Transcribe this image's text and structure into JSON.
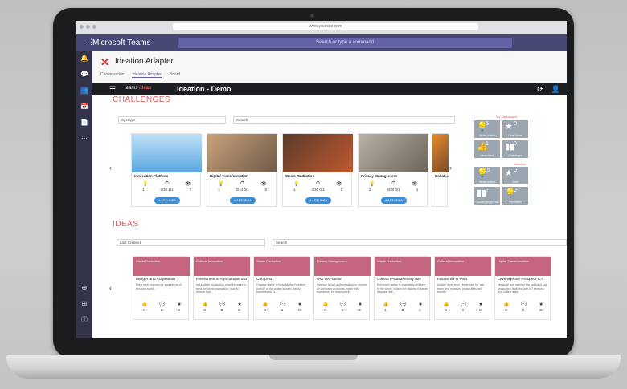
{
  "browser": {
    "url": "www.yoursite.com"
  },
  "teams": {
    "app_name": "Microsoft Teams",
    "search_placeholder": "Search or type a command",
    "rail": [
      "Activity",
      "Chat",
      "Teams",
      "Meetings",
      "Files",
      "...",
      "Apps",
      "Store",
      "Help"
    ]
  },
  "app": {
    "name": "Ideation Adapter",
    "tabs": [
      "Conversation",
      "Ideation Adapter",
      "Board"
    ],
    "bar_title": "Ideation - Demo",
    "brand_text": "teams",
    "brand_accent": "ideas"
  },
  "challenges": {
    "heading": "CHALLENGES",
    "filter_label": "Spotlight",
    "search_placeholder": "Search",
    "cards": [
      {
        "title": "Innovation Platform",
        "likes": "1",
        "date": "3/30 1/1",
        "views": "7",
        "add": "+ ADD IDEA"
      },
      {
        "title": "Digital Transformation",
        "likes": "1",
        "date": "2/14 0/1",
        "views": "0",
        "add": "+ ADD IDEA"
      },
      {
        "title": "Waste Reduction",
        "likes": "1",
        "date": "3/30 0/1",
        "views": "2",
        "add": "+ ADD IDEA"
      },
      {
        "title": "Privacy Management",
        "likes": "2",
        "date": "4/30 0/1",
        "views": "4",
        "add": "+ ADD IDEA"
      },
      {
        "title": "Collab...",
        "likes": "",
        "date": "",
        "views": "",
        "add": ""
      }
    ]
  },
  "stats": {
    "label1": "My Dashboard",
    "label2": "Ideation",
    "tiles": [
      {
        "num": "5",
        "label": "Ideas posted"
      },
      {
        "num": "0",
        "label": "Liked ideas"
      },
      {
        "num": "1",
        "label": "Ideas liked"
      },
      {
        "num": "0",
        "label": "Challenges"
      },
      {
        "num": "15",
        "label": "Ideas posted"
      },
      {
        "num": "0",
        "label": "Liked"
      },
      {
        "num": "7",
        "label": "Challenges posted"
      },
      {
        "num": "0",
        "label": "Reviewed"
      }
    ]
  },
  "ideas": {
    "heading": "IDEAS",
    "sort_label": "Last Created",
    "search_placeholder": "Search",
    "cards": [
      {
        "category": "Waste Reduction",
        "title": "Merger and Acquisition",
        "desc": "Drive new process for acquisition of medium sized...",
        "likes": "0",
        "comments": "1",
        "stars": "0"
      },
      {
        "category": "Cultural Innovation",
        "title": "Investment in Agricultural Technology",
        "desc": "Agriculture production must increase to feed the world population; how to ensure that...",
        "likes": "0",
        "comments": "0",
        "stars": "0"
      },
      {
        "category": "Waste Reduction",
        "title": "Compost",
        "desc": "Organic waste is typically the heaviest portion of the waste stream; easily transformed to...",
        "likes": "0",
        "comments": "1",
        "stars": "0"
      },
      {
        "category": "Privacy Management",
        "title": "Use two-factor",
        "desc": "Use two factor authentication to secure all company accounts, make this mandatory for employees.",
        "likes": "0",
        "comments": "0",
        "stars": "0"
      },
      {
        "category": "Waste Reduction",
        "title": "Collect e-waste every day",
        "desc": "Electronic waste is a growing problem in the world; collect the biggest e-waste disposal site...",
        "likes": "1",
        "comments": "2",
        "stars": "2"
      },
      {
        "category": "Cultural Innovation",
        "title": "Initiate WFH Pilot",
        "desc": "Initiate Work from Home pilot for one team and measure productivity and results.",
        "likes": "0",
        "comments": "0",
        "stars": "0"
      },
      {
        "category": "Digital Transformation",
        "title": "Leverage the Prospect IoT",
        "desc": "Measure and monitor the output of our production facilities with IoT sensors and collect data...",
        "likes": "0",
        "comments": "0",
        "stars": "0"
      }
    ]
  }
}
